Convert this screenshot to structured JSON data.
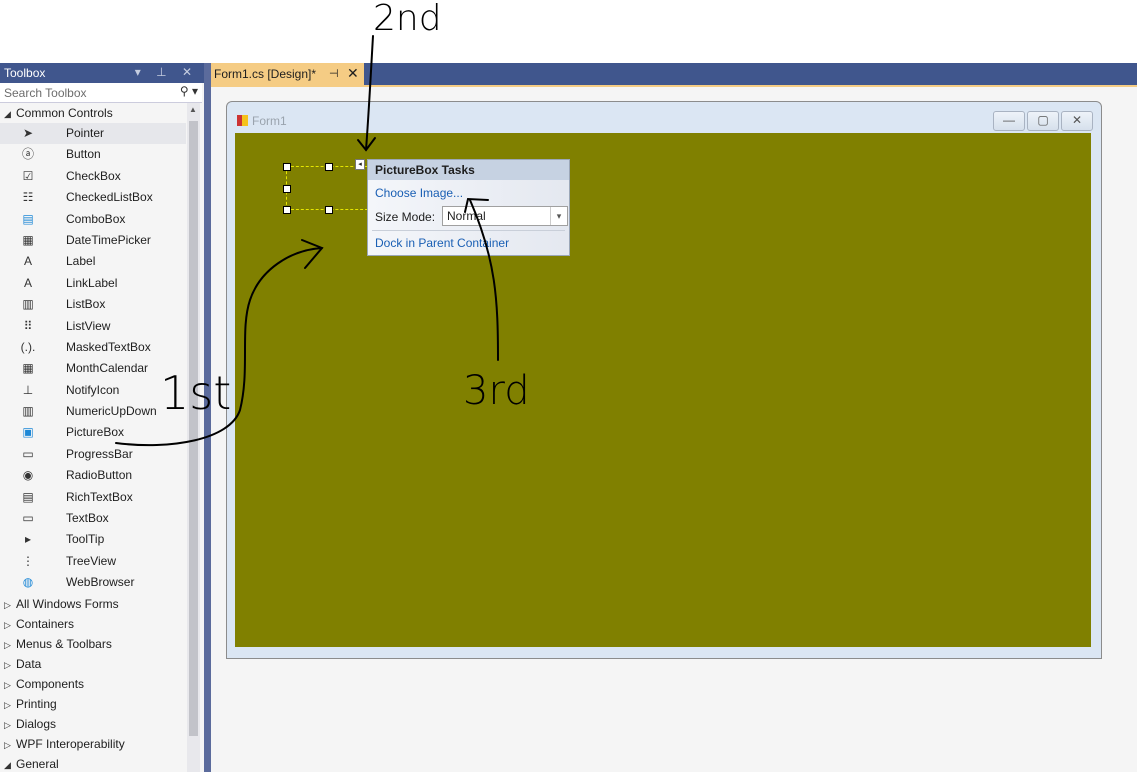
{
  "toolbox": {
    "title": "Toolbox",
    "controls": "▾ ⊥ ✕",
    "search_placeholder": "Search Toolbox",
    "search_icon": "⚲ ▾",
    "common_controls": {
      "label": "Common Controls",
      "expanded": true,
      "items": [
        {
          "label": "Pointer",
          "icon": "pointer-icon",
          "glyph": "➤"
        },
        {
          "label": "Button",
          "icon": "button-icon",
          "glyph": "ⓐ"
        },
        {
          "label": "CheckBox",
          "icon": "checkbox-icon",
          "glyph": "☑"
        },
        {
          "label": "CheckedListBox",
          "icon": "checked-list-icon",
          "glyph": "☷"
        },
        {
          "label": "ComboBox",
          "icon": "combobox-icon",
          "glyph": "▤"
        },
        {
          "label": "DateTimePicker",
          "icon": "calendar-icon",
          "glyph": "▦"
        },
        {
          "label": "Label",
          "icon": "label-icon",
          "glyph": "A"
        },
        {
          "label": "LinkLabel",
          "icon": "link-label-icon",
          "glyph": "A"
        },
        {
          "label": "ListBox",
          "icon": "listbox-icon",
          "glyph": "▥"
        },
        {
          "label": "ListView",
          "icon": "listview-icon",
          "glyph": "⠿"
        },
        {
          "label": "MaskedTextBox",
          "icon": "masked-textbox-icon",
          "glyph": "(.)."
        },
        {
          "label": "MonthCalendar",
          "icon": "month-calendar-icon",
          "glyph": "▦"
        },
        {
          "label": "NotifyIcon",
          "icon": "notify-icon",
          "glyph": "⊥"
        },
        {
          "label": "NumericUpDown",
          "icon": "numeric-updown-icon",
          "glyph": "▥"
        },
        {
          "label": "PictureBox",
          "icon": "picture-icon",
          "glyph": "▣"
        },
        {
          "label": "ProgressBar",
          "icon": "progressbar-icon",
          "glyph": "▭"
        },
        {
          "label": "RadioButton",
          "icon": "radio-icon",
          "glyph": "◉"
        },
        {
          "label": "RichTextBox",
          "icon": "richtextbox-icon",
          "glyph": "▤"
        },
        {
          "label": "TextBox",
          "icon": "textbox-icon",
          "glyph": "▭"
        },
        {
          "label": "ToolTip",
          "icon": "tooltip-icon",
          "glyph": "▸"
        },
        {
          "label": "TreeView",
          "icon": "treeview-icon",
          "glyph": "⋮"
        },
        {
          "label": "WebBrowser",
          "icon": "webbrowser-icon",
          "glyph": "◍"
        }
      ]
    },
    "categories": [
      {
        "label": "All Windows Forms",
        "expanded": false
      },
      {
        "label": "Containers",
        "expanded": false
      },
      {
        "label": "Menus & Toolbars",
        "expanded": false
      },
      {
        "label": "Data",
        "expanded": false
      },
      {
        "label": "Components",
        "expanded": false
      },
      {
        "label": "Printing",
        "expanded": false
      },
      {
        "label": "Dialogs",
        "expanded": false
      },
      {
        "label": "WPF Interoperability",
        "expanded": false
      },
      {
        "label": "General",
        "expanded": true
      }
    ]
  },
  "document": {
    "tab_label": "Form1.cs [Design]*",
    "tab_pin": "⊣",
    "tab_close": "✕"
  },
  "form": {
    "caption": "Form1",
    "buttons": {
      "minimize": "—",
      "maximize": "▢",
      "close": "✕"
    },
    "back_color": "#808000"
  },
  "picturebox_tasks": {
    "title": "PictureBox Tasks",
    "choose_image": "Choose Image...",
    "size_mode_label": "Size Mode:",
    "size_mode_value": "Normal",
    "dock_link": "Dock in Parent Container"
  },
  "annotations": {
    "first": "1st",
    "second": "2nd",
    "third": "3rd"
  }
}
